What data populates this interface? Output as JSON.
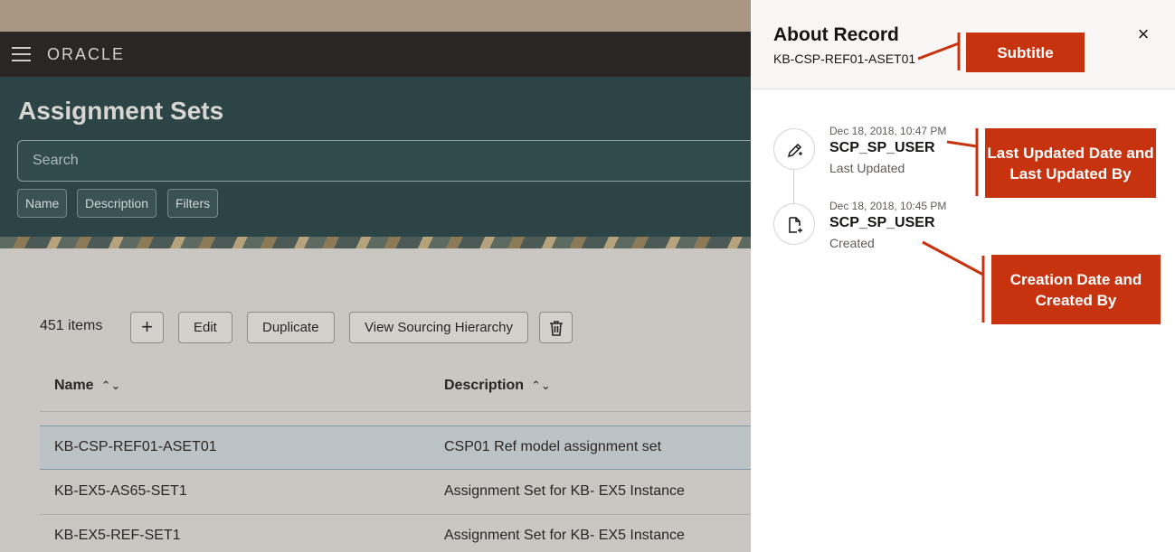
{
  "navbar": {
    "logo": "ORACLE"
  },
  "page": {
    "title": "Assignment Sets",
    "search_placeholder": "Search",
    "chips": [
      "Name",
      "Description",
      "Filters"
    ]
  },
  "toolbar": {
    "count": "451 items",
    "add": "+",
    "edit": "Edit",
    "duplicate": "Duplicate",
    "view": "View Sourcing Hierarchy",
    "delete_icon": "trash-icon"
  },
  "table": {
    "headers": [
      "Name",
      "Description"
    ],
    "rows": [
      {
        "name": "KB-CSP-REF01-ASET01",
        "description": "CSP01 Ref model assignment set",
        "selected": true
      },
      {
        "name": "KB-EX5-AS65-SET1",
        "description": "Assignment Set for KB- EX5 Instance"
      },
      {
        "name": "KB-EX5-REF-SET1",
        "description": "Assignment Set for KB- EX5 Instance"
      }
    ]
  },
  "drawer": {
    "title": "About Record",
    "subtitle": "KB-CSP-REF01-ASET01",
    "close": "×",
    "events": [
      {
        "date": "Dec 18, 2018, 10:47 PM",
        "user": "SCP_SP_USER",
        "label": "Last Updated",
        "icon": "edit-icon"
      },
      {
        "date": "Dec 18, 2018, 10:45 PM",
        "user": "SCP_SP_USER",
        "label": "Created",
        "icon": "new-document-icon"
      }
    ]
  },
  "annotations": {
    "subtitle": "Subtitle",
    "last_updated": "Last Updated Date and Last Updated By",
    "created": "Creation Date and Created By"
  },
  "colors": {
    "callout": "#c7330f",
    "hero": "#2d4446",
    "navbar": "#2a2623"
  }
}
